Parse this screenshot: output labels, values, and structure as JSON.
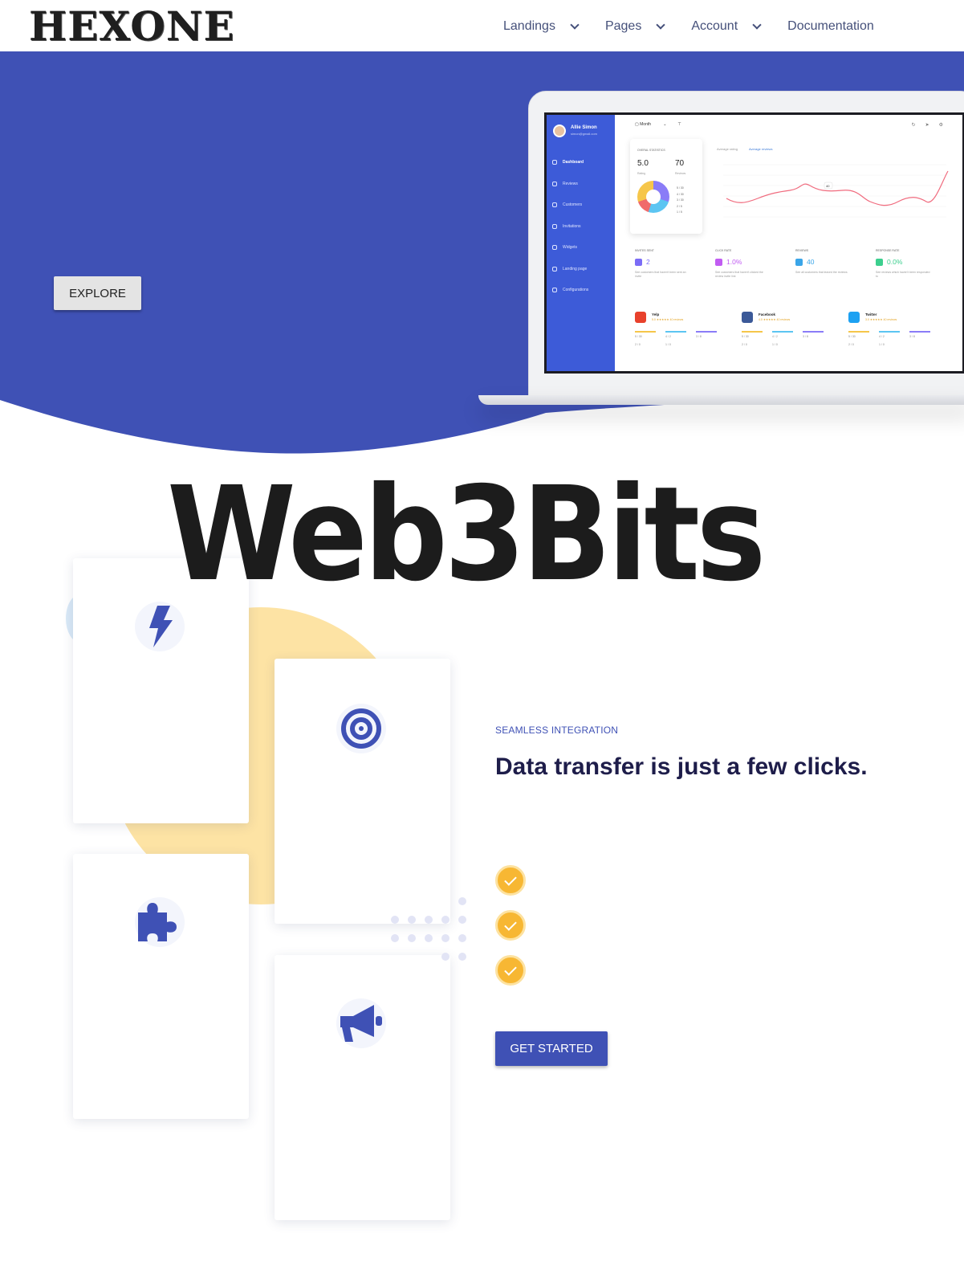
{
  "brand": {
    "logo_text": "HEXONE"
  },
  "nav": {
    "items": [
      {
        "label": "Landings",
        "has_dropdown": true
      },
      {
        "label": "Pages",
        "has_dropdown": true
      },
      {
        "label": "Account",
        "has_dropdown": true
      },
      {
        "label": "Documentation",
        "has_dropdown": false
      }
    ]
  },
  "hero": {
    "explore_label": "EXPLORE",
    "background_color": "#3f51b5"
  },
  "dashboard": {
    "user_name": "Allie Simon",
    "user_email": "simon@gmail.com",
    "period": "Month",
    "menu": [
      "Dashboard",
      "Reviews",
      "Customers",
      "Invitations",
      "Widgets",
      "Landing page",
      "Configurations"
    ],
    "overall_caption": "Overal statistics",
    "rating_value": "5.0",
    "rating_label": "Rating",
    "reviews_value": "70",
    "reviews_label": "Reviews",
    "legend": [
      "5 / 30",
      "4 / 30",
      "3 / 30",
      "2 / 5",
      "1 / 5"
    ],
    "chart_tab_1": "Average rating",
    "chart_tab_2": "Average reviews",
    "chart_point_label": "40",
    "metrics": [
      {
        "caption": "Invites sent",
        "value": "2",
        "text": "See customers that haven't been sent an invite",
        "color": "#7b6cf6"
      },
      {
        "caption": "Click rate",
        "value": "1.0%",
        "text": "See customers that haven't clicked the review invite link",
        "color": "#c15cf2"
      },
      {
        "caption": "Reviews",
        "value": "40",
        "text": "See all customers that leaved the reviews",
        "color": "#3aa5e8"
      },
      {
        "caption": "Response rate",
        "value": "0.0%",
        "text": "See reviews which haven't been responded to",
        "color": "#3ccf8e"
      }
    ],
    "socials": [
      {
        "name": "Yelp",
        "rating": "5.0 ★★★★★ 40 reviews",
        "color": "#e8412c"
      },
      {
        "name": "Facebook",
        "rating": "4.0 ★★★★★ 40 reviews",
        "color": "#3b5998"
      },
      {
        "name": "Twitter",
        "rating": "3.0 ★★★★★ 40 reviews",
        "color": "#1da1f2"
      }
    ],
    "bar_labels": [
      "5 / 30",
      "4 / 2",
      "3 / 8",
      "2 / 0",
      "1 / 0"
    ]
  },
  "title": {
    "text": "Web3Bits"
  },
  "features": {
    "cards": [
      {
        "icon": "lightning-icon"
      },
      {
        "icon": "target-icon"
      },
      {
        "icon": "puzzle-icon"
      },
      {
        "icon": "megaphone-icon"
      }
    ],
    "accent_color": "#3f51b5"
  },
  "integration": {
    "eyebrow": "SEAMLESS INTEGRATION",
    "headline": "Data transfer is just a few clicks.",
    "checks": 3,
    "cta_label": "GET STARTED"
  }
}
